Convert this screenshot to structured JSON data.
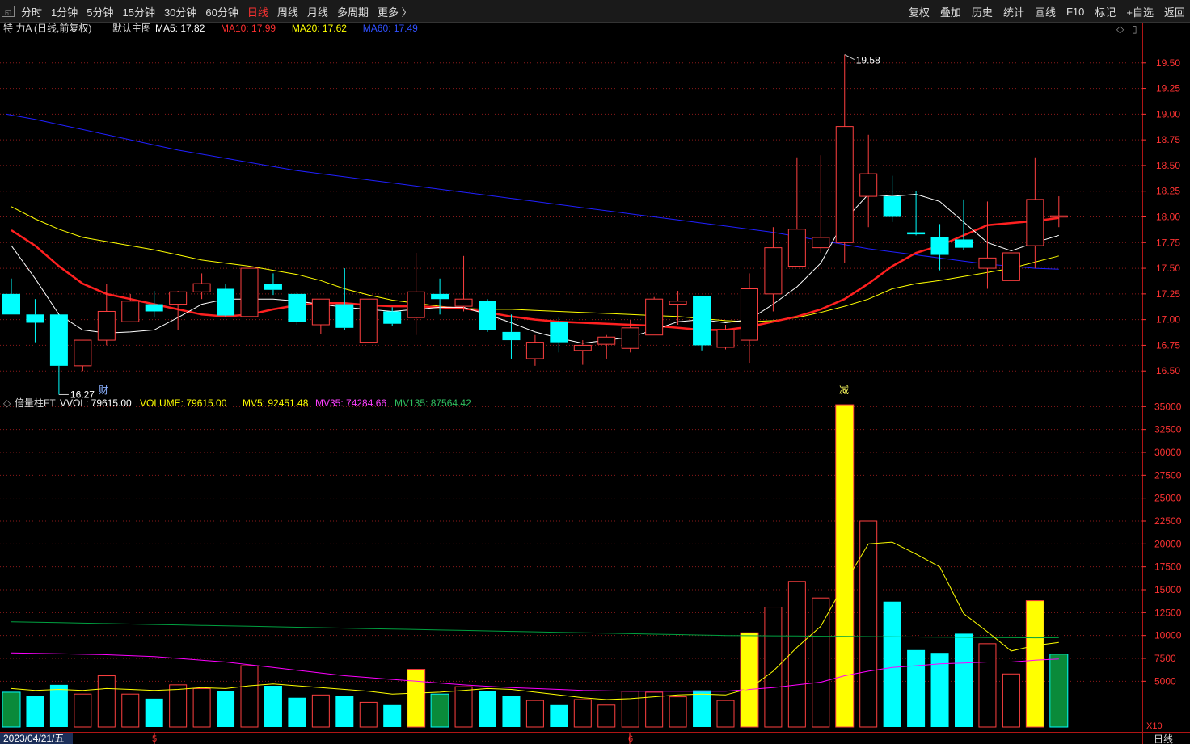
{
  "toolbar": {
    "icon_glyph": "◱",
    "periods": [
      "分时",
      "1分钟",
      "5分钟",
      "15分钟",
      "30分钟",
      "60分钟",
      "日线",
      "周线",
      "月线",
      "多周期",
      "更多 〉"
    ],
    "active_period": "日线",
    "tools": [
      "复权",
      "叠加",
      "历史",
      "统计",
      "画线",
      "F10",
      "标记",
      "+自选",
      "返回"
    ]
  },
  "colors": {
    "up": "#ff4040",
    "down": "#00ffff",
    "ma5": "#ffffff",
    "ma10": "#ff2020",
    "ma20": "#ffff00",
    "ma60": "#2020ff",
    "grid": "#8b1a1a",
    "axis_text": "#ff3333",
    "vol_yellow": "#ffff00",
    "vol_cyan": "#00ffff",
    "vol_green": "#0a8a3a",
    "mv5": "#ffff00",
    "mv35": "#ff00ff",
    "mv135": "#00a040"
  },
  "price_panel": {
    "stock_name": "特 力A (日线,前复权)",
    "main_label": "默认主图",
    "ma_labels": [
      {
        "text": "MA5: 17.82",
        "color": "#ffffff"
      },
      {
        "text": "MA10: 17.99",
        "color": "#ff3030"
      },
      {
        "text": "MA20: 17.62",
        "color": "#ffff00"
      },
      {
        "text": "MA60: 17.49",
        "color": "#3050ff"
      }
    ],
    "high_annotation": "19.58",
    "low_annotation": "16.27",
    "event_marks": [
      "财",
      "减"
    ],
    "corner_icons": [
      "◇",
      "▯"
    ]
  },
  "volume_panel": {
    "title": "倍量柱FT",
    "labels": [
      {
        "text": "VVOL: 79615.00",
        "color": "#ffffff"
      },
      {
        "text": "VOLUME: 79615.00",
        "color": "#ffff00"
      },
      {
        "text": "MV5: 92451.48",
        "color": "#ffff00"
      },
      {
        "text": "MV35: 74284.66",
        "color": "#ff40ff"
      },
      {
        "text": "MV135: 87564.42",
        "color": "#30c060"
      }
    ],
    "unit_label": "X10"
  },
  "footer": {
    "date": "2023/04/21/五",
    "month_marks": [
      "5",
      "6"
    ],
    "period_label": "日线"
  },
  "chart_data": {
    "type": "candlestick",
    "price_axis": {
      "ylim": [
        16.25,
        19.75
      ],
      "ticks": [
        16.5,
        16.75,
        17.0,
        17.25,
        17.5,
        17.75,
        18.0,
        18.25,
        18.5,
        18.75,
        19.0,
        19.25,
        19.5
      ]
    },
    "candles": [
      {
        "o": 17.25,
        "h": 17.4,
        "l": 17.05,
        "c": 17.05
      },
      {
        "o": 17.05,
        "h": 17.2,
        "l": 16.78,
        "c": 16.97
      },
      {
        "o": 17.05,
        "h": 17.05,
        "l": 16.27,
        "c": 16.55
      },
      {
        "o": 16.55,
        "h": 16.8,
        "l": 16.5,
        "c": 16.8
      },
      {
        "o": 16.8,
        "h": 17.35,
        "l": 16.75,
        "c": 17.08
      },
      {
        "o": 16.98,
        "h": 17.25,
        "l": 16.98,
        "c": 17.18
      },
      {
        "o": 17.15,
        "h": 17.28,
        "l": 17.02,
        "c": 17.08
      },
      {
        "o": 17.15,
        "h": 17.28,
        "l": 16.9,
        "c": 17.27
      },
      {
        "o": 17.27,
        "h": 17.45,
        "l": 17.2,
        "c": 17.35
      },
      {
        "o": 17.3,
        "h": 17.35,
        "l": 17.03,
        "c": 17.04
      },
      {
        "o": 17.03,
        "h": 17.5,
        "l": 17.03,
        "c": 17.5
      },
      {
        "o": 17.35,
        "h": 17.45,
        "l": 17.24,
        "c": 17.29
      },
      {
        "o": 17.25,
        "h": 17.27,
        "l": 16.95,
        "c": 16.98
      },
      {
        "o": 16.95,
        "h": 17.2,
        "l": 16.86,
        "c": 17.2
      },
      {
        "o": 17.15,
        "h": 17.5,
        "l": 16.9,
        "c": 16.92
      },
      {
        "o": 16.78,
        "h": 17.2,
        "l": 16.78,
        "c": 17.2
      },
      {
        "o": 17.08,
        "h": 17.12,
        "l": 16.94,
        "c": 16.96
      },
      {
        "o": 17.02,
        "h": 17.65,
        "l": 16.85,
        "c": 17.27
      },
      {
        "o": 17.25,
        "h": 17.4,
        "l": 17.05,
        "c": 17.2
      },
      {
        "o": 17.13,
        "h": 17.62,
        "l": 17.08,
        "c": 17.2
      },
      {
        "o": 17.18,
        "h": 17.2,
        "l": 16.88,
        "c": 16.9
      },
      {
        "o": 16.88,
        "h": 17.05,
        "l": 16.62,
        "c": 16.8
      },
      {
        "o": 16.62,
        "h": 16.85,
        "l": 16.55,
        "c": 16.78
      },
      {
        "o": 16.98,
        "h": 17.02,
        "l": 16.68,
        "c": 16.78
      },
      {
        "o": 16.7,
        "h": 16.8,
        "l": 16.56,
        "c": 16.75
      },
      {
        "o": 16.76,
        "h": 16.85,
        "l": 16.62,
        "c": 16.83
      },
      {
        "o": 16.72,
        "h": 17.0,
        "l": 16.68,
        "c": 16.92
      },
      {
        "o": 16.85,
        "h": 17.22,
        "l": 16.85,
        "c": 17.2
      },
      {
        "o": 17.15,
        "h": 17.28,
        "l": 16.95,
        "c": 17.18
      },
      {
        "o": 17.23,
        "h": 17.23,
        "l": 16.7,
        "c": 16.75
      },
      {
        "o": 16.73,
        "h": 16.95,
        "l": 16.71,
        "c": 16.9
      },
      {
        "o": 16.8,
        "h": 17.45,
        "l": 16.58,
        "c": 17.3
      },
      {
        "o": 17.25,
        "h": 17.9,
        "l": 17.08,
        "c": 17.7
      },
      {
        "o": 17.52,
        "h": 18.58,
        "l": 17.52,
        "c": 17.88
      },
      {
        "o": 17.7,
        "h": 18.6,
        "l": 17.65,
        "c": 17.8
      },
      {
        "o": 17.75,
        "h": 19.58,
        "l": 17.55,
        "c": 18.88
      },
      {
        "o": 18.2,
        "h": 18.8,
        "l": 17.9,
        "c": 18.42
      },
      {
        "o": 18.2,
        "h": 18.4,
        "l": 17.95,
        "c": 18.0
      },
      {
        "o": 17.85,
        "h": 18.25,
        "l": 17.82,
        "c": 17.83
      },
      {
        "o": 17.8,
        "h": 17.93,
        "l": 17.48,
        "c": 17.63
      },
      {
        "o": 17.78,
        "h": 18.17,
        "l": 17.68,
        "c": 17.7
      },
      {
        "o": 17.5,
        "h": 18.15,
        "l": 17.3,
        "c": 17.6
      },
      {
        "o": 17.38,
        "h": 17.65,
        "l": 17.38,
        "c": 17.65
      },
      {
        "o": 17.72,
        "h": 18.58,
        "l": 17.5,
        "c": 18.17
      },
      {
        "o": 18.0,
        "h": 18.2,
        "l": 17.9,
        "c": 18.01
      }
    ],
    "ma5": [
      17.72,
      17.4,
      17.05,
      16.9,
      16.87,
      16.88,
      16.9,
      17.02,
      17.15,
      17.2,
      17.2,
      17.2,
      17.18,
      17.15,
      17.12,
      17.1,
      17.08,
      17.1,
      17.12,
      17.12,
      17.05,
      16.97,
      16.88,
      16.82,
      16.77,
      16.8,
      16.83,
      16.9,
      16.98,
      17.0,
      16.97,
      17.0,
      17.15,
      17.32,
      17.55,
      17.97,
      18.22,
      18.2,
      18.22,
      18.15,
      17.95,
      17.75,
      17.67,
      17.75,
      17.82
    ],
    "ma10": [
      17.87,
      17.72,
      17.52,
      17.35,
      17.25,
      17.2,
      17.15,
      17.1,
      17.05,
      17.03,
      17.05,
      17.1,
      17.14,
      17.16,
      17.16,
      17.14,
      17.13,
      17.13,
      17.12,
      17.11,
      17.07,
      17.03,
      17.0,
      16.98,
      16.97,
      16.96,
      16.95,
      16.94,
      16.92,
      16.9,
      16.9,
      16.93,
      16.98,
      17.03,
      17.1,
      17.2,
      17.35,
      17.52,
      17.65,
      17.72,
      17.82,
      17.92,
      17.94,
      17.96,
      17.99
    ],
    "ma20": [
      18.1,
      17.98,
      17.88,
      17.8,
      17.76,
      17.72,
      17.68,
      17.63,
      17.58,
      17.55,
      17.52,
      17.48,
      17.44,
      17.38,
      17.3,
      17.24,
      17.19,
      17.16,
      17.13,
      17.11,
      17.1,
      17.1,
      17.09,
      17.08,
      17.07,
      17.06,
      17.05,
      17.04,
      17.03,
      17.01,
      16.99,
      16.98,
      16.99,
      17.02,
      17.07,
      17.13,
      17.2,
      17.3,
      17.35,
      17.38,
      17.42,
      17.46,
      17.5,
      17.56,
      17.62
    ],
    "ma60": [
      19.0,
      18.95,
      18.9,
      18.85,
      18.8,
      18.75,
      18.7,
      18.65,
      18.61,
      18.57,
      18.53,
      18.49,
      18.45,
      18.42,
      18.39,
      18.36,
      18.33,
      18.3,
      18.27,
      18.24,
      18.21,
      18.18,
      18.15,
      18.12,
      18.09,
      18.06,
      18.03,
      18.0,
      17.97,
      17.94,
      17.91,
      17.88,
      17.85,
      17.81,
      17.77,
      17.73,
      17.69,
      17.66,
      17.63,
      17.6,
      17.57,
      17.54,
      17.52,
      17.5,
      17.49
    ],
    "volume_axis": {
      "ylim": [
        0,
        36000
      ],
      "ticks": [
        5000,
        7500,
        10000,
        12500,
        15000,
        17500,
        20000,
        22500,
        25000,
        27500,
        30000,
        32500,
        35000
      ],
      "unit_multiplier": 10
    },
    "volumes": [
      {
        "v": 3800,
        "color": "green"
      },
      {
        "v": 3400,
        "color": "cyan"
      },
      {
        "v": 4600,
        "color": "cyan"
      },
      {
        "v": 3600,
        "color": "red"
      },
      {
        "v": 5600,
        "color": "red"
      },
      {
        "v": 3600,
        "color": "red"
      },
      {
        "v": 3100,
        "color": "cyan"
      },
      {
        "v": 4600,
        "color": "red"
      },
      {
        "v": 4200,
        "color": "red"
      },
      {
        "v": 3900,
        "color": "cyan"
      },
      {
        "v": 6700,
        "color": "red"
      },
      {
        "v": 4500,
        "color": "cyan"
      },
      {
        "v": 3200,
        "color": "cyan"
      },
      {
        "v": 3500,
        "color": "red"
      },
      {
        "v": 3400,
        "color": "cyan"
      },
      {
        "v": 2700,
        "color": "red"
      },
      {
        "v": 2400,
        "color": "cyan"
      },
      {
        "v": 6300,
        "color": "yellow"
      },
      {
        "v": 3600,
        "color": "green"
      },
      {
        "v": 4400,
        "color": "red"
      },
      {
        "v": 3900,
        "color": "cyan"
      },
      {
        "v": 3400,
        "color": "cyan"
      },
      {
        "v": 2900,
        "color": "red"
      },
      {
        "v": 2400,
        "color": "cyan"
      },
      {
        "v": 3000,
        "color": "red"
      },
      {
        "v": 2400,
        "color": "red"
      },
      {
        "v": 3900,
        "color": "red"
      },
      {
        "v": 3800,
        "color": "red"
      },
      {
        "v": 3300,
        "color": "red"
      },
      {
        "v": 4000,
        "color": "cyan"
      },
      {
        "v": 2900,
        "color": "red"
      },
      {
        "v": 10300,
        "color": "yellow"
      },
      {
        "v": 13100,
        "color": "red"
      },
      {
        "v": 15900,
        "color": "red"
      },
      {
        "v": 14100,
        "color": "red"
      },
      {
        "v": 35200,
        "color": "yellow"
      },
      {
        "v": 22500,
        "color": "red"
      },
      {
        "v": 13700,
        "color": "cyan"
      },
      {
        "v": 8400,
        "color": "cyan"
      },
      {
        "v": 8100,
        "color": "cyan"
      },
      {
        "v": 10200,
        "color": "cyan"
      },
      {
        "v": 9100,
        "color": "red"
      },
      {
        "v": 5800,
        "color": "red"
      },
      {
        "v": 13800,
        "color": "yellow"
      },
      {
        "v": 7962,
        "color": "green"
      }
    ],
    "mv5": [
      4200,
      4000,
      4100,
      4000,
      4200,
      4100,
      4000,
      4100,
      4300,
      4200,
      4500,
      4700,
      4500,
      4300,
      4100,
      3900,
      3600,
      3700,
      3800,
      4000,
      4200,
      4100,
      3800,
      3500,
      3200,
      3000,
      3100,
      3300,
      3500,
      3600,
      3500,
      4200,
      6100,
      8700,
      11000,
      15700,
      20000,
      20200,
      18900,
      17500,
      12400,
      10400,
      8300,
      8900,
      9245
    ],
    "mv35": [
      8100,
      8050,
      8000,
      7950,
      7900,
      7800,
      7700,
      7500,
      7300,
      7100,
      6800,
      6500,
      6200,
      5900,
      5600,
      5400,
      5200,
      5000,
      4800,
      4600,
      4450,
      4300,
      4200,
      4100,
      4000,
      3950,
      3900,
      3900,
      3900,
      3900,
      3900,
      4100,
      4300,
      4600,
      4900,
      5600,
      6100,
      6500,
      6700,
      6900,
      7000,
      7100,
      7100,
      7300,
      7428
    ],
    "mv135": [
      11500,
      11450,
      11400,
      11350,
      11300,
      11250,
      11200,
      11150,
      11100,
      11050,
      11000,
      10950,
      10900,
      10850,
      10800,
      10750,
      10700,
      10650,
      10600,
      10550,
      10500,
      10450,
      10400,
      10350,
      10300,
      10250,
      10200,
      10150,
      10100,
      10050,
      10000,
      9980,
      9960,
      9940,
      9920,
      9900,
      9880,
      9860,
      9840,
      9820,
      9800,
      9780,
      9760,
      9740,
      9756
    ]
  }
}
